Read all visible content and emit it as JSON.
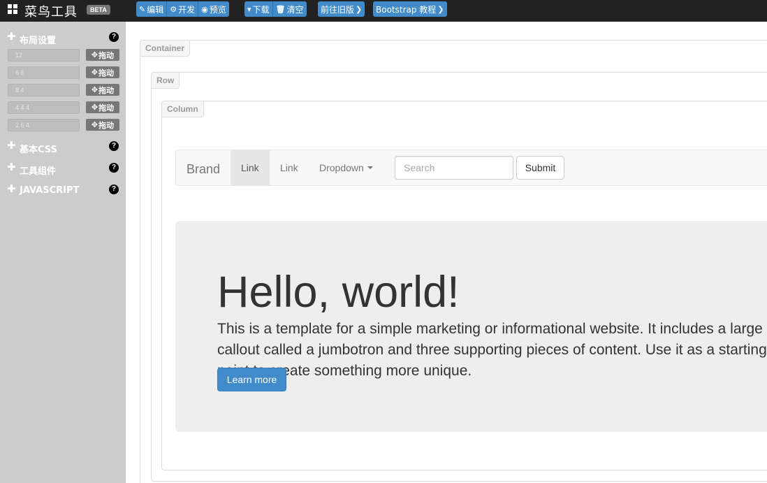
{
  "topbar": {
    "title": "菜鸟工具",
    "beta": "BETA",
    "actions": [
      {
        "icon": "edit-icon",
        "glyph": "✎",
        "label": "编辑"
      },
      {
        "icon": "dev-icon",
        "glyph": "⚙",
        "label": "开发"
      },
      {
        "icon": "eye-icon",
        "glyph": "◉",
        "label": "预览"
      }
    ],
    "file_actions": [
      {
        "icon": "chevron-down-icon",
        "glyph": "▾",
        "label": "下载"
      },
      {
        "icon": "trash-icon",
        "glyph": "🗑",
        "label": "清空"
      }
    ],
    "old_version": "前往旧版",
    "bootstrap_tutorial": "Bootstrap 教程"
  },
  "sidebar": {
    "layout_section": "布局设置",
    "rows": [
      {
        "value": "12",
        "drag": "拖动"
      },
      {
        "value": "6 6",
        "drag": "拖动"
      },
      {
        "value": "8 4",
        "drag": "拖动"
      },
      {
        "value": "4 4 4",
        "drag": "拖动"
      },
      {
        "value": "2 6 4",
        "drag": "拖动"
      }
    ],
    "sections": [
      "基本CSS",
      "工具组件",
      "JAVASCRIPT"
    ]
  },
  "canvas": {
    "container_tag": "Container",
    "row_tag": "Row",
    "column_tag": "Column",
    "navbar": {
      "brand": "Brand",
      "link_active": "Link",
      "link": "Link",
      "dropdown": "Dropdown",
      "search_placeholder": "Search",
      "submit": "Submit"
    },
    "jumbotron": {
      "heading": "Hello, world!",
      "text": "This is a template for a simple marketing or informational website. It includes a large callout called a jumbotron and three supporting pieces of content. Use it as a starting point to create something more unique.",
      "button": "Learn more"
    }
  },
  "colors": {
    "primary": "#428bca",
    "topbar": "#222222",
    "sidebar": "#cccccc"
  }
}
